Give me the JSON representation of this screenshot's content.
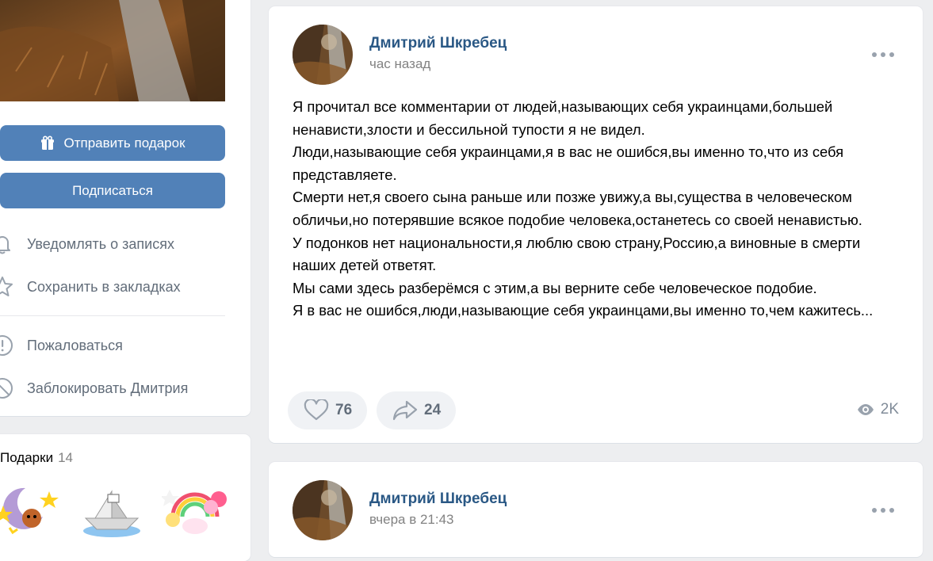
{
  "sidebar": {
    "send_gift_label": "Отправить подарок",
    "subscribe_label": "Подписаться",
    "menu": [
      {
        "label": "Уведомлять о записях",
        "icon": "bell-icon"
      },
      {
        "label": "Сохранить в закладках",
        "icon": "star-icon"
      },
      {
        "label": "Пожаловаться",
        "icon": "report-icon"
      },
      {
        "label": "Заблокировать Дмитрия",
        "icon": "block-icon"
      }
    ],
    "gifts": {
      "title": "Подарки",
      "count": "14"
    }
  },
  "posts": [
    {
      "author": "Дмитрий Шкребец",
      "time": "час назад",
      "text": [
        "Я прочитал все комментарии от людей,называющих себя украинцами,большей ненависти,злости и бессильной тупости я не видел.",
        "Люди,называющие себя украинцами,я в вас не ошибся,вы именно то,что из себя представляете.",
        "Смерти нет,я своего сына раньше или позже увижу,а вы,существа в человеческом обличьи,но потерявшие всякое подобие человека,останетесь со своей ненавистью.",
        "У подонков нет национальности,я люблю свою страну,Россию,а виновные в смерти наших детей ответят.",
        "Мы сами здесь разберёмся с этим,а вы верните себе человеческое подобие.",
        "Я в вас не ошибся,люди,называющие себя украинцами,вы именно то,чем кажитесь..."
      ],
      "likes": "76",
      "shares": "24",
      "views": "2K"
    },
    {
      "author": "Дмитрий Шкребец",
      "time": "вчера в 21:43"
    }
  ],
  "colors": {
    "accent": "#5181b8",
    "link": "#2a5885",
    "background": "#edeef0"
  }
}
